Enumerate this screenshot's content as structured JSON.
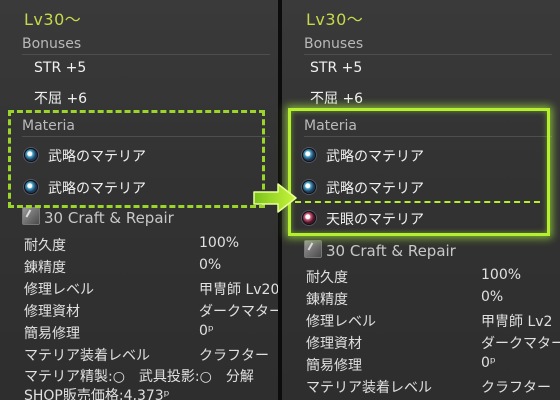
{
  "left": {
    "level": "Lv30～",
    "bonuses_title": "Bonuses",
    "bonuses": [
      "STR +5",
      "不屈 +6"
    ],
    "materia_title": "Materia",
    "materia": [
      {
        "name": "武略のマテリア",
        "color": "#4aa6c8"
      },
      {
        "name": "武略のマテリア",
        "color": "#4aa6c8"
      }
    ],
    "craft_header": "30 Craft & Repair",
    "stats": [
      {
        "label": "耐久度",
        "value": "100%"
      },
      {
        "label": "錬精度",
        "value": "0%"
      },
      {
        "label": "修理レベル",
        "value": "甲冑師 Lv20"
      },
      {
        "label": "修理資材",
        "value": "ダークマター"
      },
      {
        "label": "簡易修理",
        "value": "0ᵖ"
      },
      {
        "label": "マテリア装着レベル",
        "value": "クラフター"
      }
    ],
    "flags_line": "マテリア精製:○　武具投影:○　分解",
    "shop_line": "SHOP販売価格:4,373ᵖ"
  },
  "right": {
    "level": "Lv30～",
    "bonuses_title": "Bonuses",
    "bonuses": [
      "STR +5",
      "不屈 +6"
    ],
    "materia_title": "Materia",
    "materia": [
      {
        "name": "武略のマテリア",
        "color": "#4aa6c8"
      },
      {
        "name": "武略のマテリア",
        "color": "#4aa6c8"
      },
      {
        "name": "天眼のマテリア",
        "color": "#d25a7a"
      }
    ],
    "craft_header": "30 Craft & Repair",
    "stats": [
      {
        "label": "耐久度",
        "value": "100%"
      },
      {
        "label": "錬精度",
        "value": "0%"
      },
      {
        "label": "修理レベル",
        "value": "甲冑師 Lv2"
      },
      {
        "label": "修理資材",
        "value": "ダークマター"
      },
      {
        "label": "簡易修理",
        "value": "0ᵖ"
      },
      {
        "label": "マテリア装着レベル",
        "value": "クラフター"
      }
    ]
  },
  "colors": {
    "highlight": "#b5f02c",
    "level_text": "#c7d94a"
  }
}
